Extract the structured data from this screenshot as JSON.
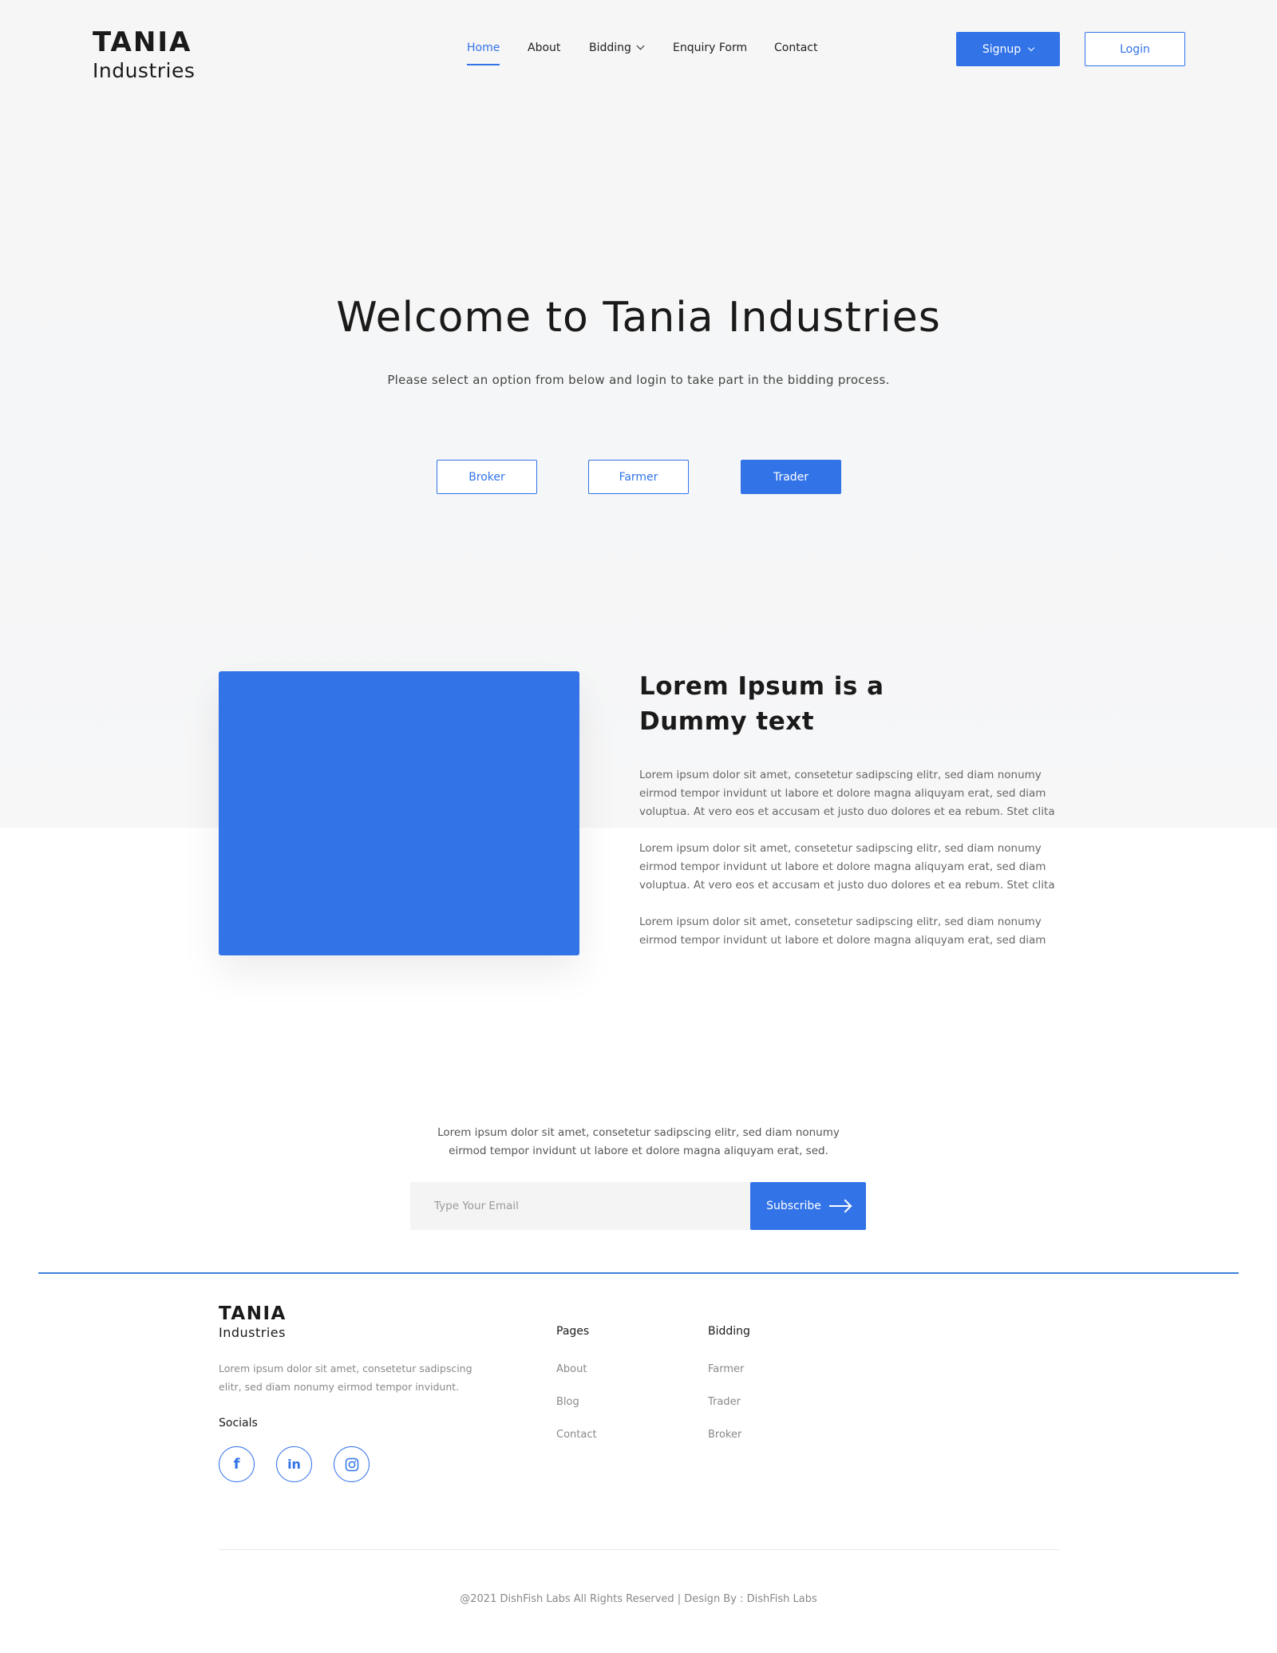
{
  "brand": {
    "line1": "TANIA",
    "line2": "Industries"
  },
  "nav": {
    "items": [
      {
        "label": "Home"
      },
      {
        "label": "About"
      },
      {
        "label": "Bidding"
      },
      {
        "label": "Enquiry Form"
      },
      {
        "label": "Contact"
      }
    ],
    "signup_label": "Signup",
    "login_label": "Login"
  },
  "hero": {
    "title": "Welcome to Tania Industries",
    "subtitle": "Please select an option from below and login to take part in the bidding process.",
    "options": [
      {
        "label": "Broker"
      },
      {
        "label": "Farmer"
      },
      {
        "label": "Trader"
      }
    ]
  },
  "feature": {
    "title_line1": "Lorem Ipsum is a",
    "title_line2": "Dummy text",
    "paragraphs": [
      "Lorem ipsum dolor sit amet, consetetur sadipscing elitr, sed diam nonumy eirmod tempor invidunt ut labore et dolore magna aliquyam erat, sed diam voluptua. At vero eos et accusam et justo duo dolores et ea rebum. Stet clita",
      "Lorem ipsum dolor sit amet, consetetur sadipscing elitr, sed diam nonumy eirmod tempor invidunt ut labore et dolore magna aliquyam erat, sed diam voluptua. At vero eos et accusam et justo duo dolores et ea rebum. Stet clita",
      "Lorem ipsum dolor sit amet, consetetur sadipscing elitr, sed diam nonumy eirmod tempor invidunt ut labore et dolore magna aliquyam erat, sed diam"
    ]
  },
  "subscribe": {
    "text_line1": "Lorem ipsum dolor sit amet, consetetur sadipscing elitr, sed diam nonumy",
    "text_line2": "eirmod tempor invidunt ut labore et dolore magna aliquyam erat, sed.",
    "placeholder": "Type Your Email",
    "button_label": "Subscribe"
  },
  "footer": {
    "brand": {
      "line1": "TANIA",
      "line2": "Industries"
    },
    "description": "Lorem ipsum dolor sit amet, consetetur sadipscing elitr, sed diam nonumy eirmod tempor invidunt.",
    "socials_title": "Socials",
    "socials": [
      {
        "icon": "facebook-icon",
        "glyph": "f"
      },
      {
        "icon": "linkedin-icon",
        "glyph": "in"
      },
      {
        "icon": "instagram-icon",
        "glyph": ""
      }
    ],
    "pages": {
      "title": "Pages",
      "links": [
        "About",
        "Blog",
        "Contact"
      ]
    },
    "bidding": {
      "title": "Bidding",
      "links": [
        "Farmer",
        "Trader",
        "Broker"
      ]
    },
    "copyright": "@2021 DishFish Labs All Rights Reserved | Design By : DishFish Labs"
  },
  "colors": {
    "accent": "#3273e8",
    "footer_rule": "#3c82d6"
  }
}
